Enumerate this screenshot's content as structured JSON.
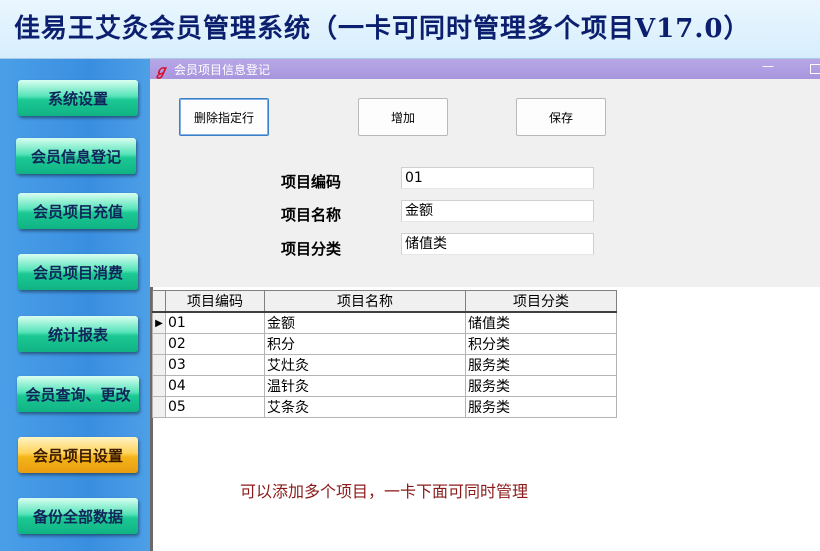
{
  "app": {
    "title": "佳易王艾灸会员管理系统（一卡可同时管理多个项目V17.0）"
  },
  "sidebar": {
    "items": [
      {
        "label": "系统设置"
      },
      {
        "label": "会员信息登记"
      },
      {
        "label": "会员项目充值"
      },
      {
        "label": "会员项目消费"
      },
      {
        "label": "统计报表"
      },
      {
        "label": "会员查询、更改"
      },
      {
        "label": "会员项目设置"
      },
      {
        "label": "备份全部数据"
      }
    ]
  },
  "window": {
    "title": "会员项目信息登记",
    "minimize_glyph": "—"
  },
  "toolbar": {
    "delete_label": "删除指定行",
    "add_label": "增加",
    "save_label": "保存"
  },
  "form": {
    "code_label": "项目编码",
    "code_value": "01",
    "name_label": "项目名称",
    "name_value": "金额",
    "category_label": "项目分类",
    "category_value": "储值类"
  },
  "grid": {
    "columns": [
      "项目编码",
      "项目名称",
      "项目分类"
    ],
    "current_marker": "▶",
    "rows": [
      {
        "code": "01",
        "name": "金额",
        "category": "储值类"
      },
      {
        "code": "02",
        "name": "积分",
        "category": "积分类"
      },
      {
        "code": "03",
        "name": "艾灶灸",
        "category": "服务类"
      },
      {
        "code": "04",
        "name": "温针灸",
        "category": "服务类"
      },
      {
        "code": "05",
        "name": "艾条灸",
        "category": "服务类"
      }
    ]
  },
  "note": "可以添加多个项目，一卡下面可同时管理"
}
